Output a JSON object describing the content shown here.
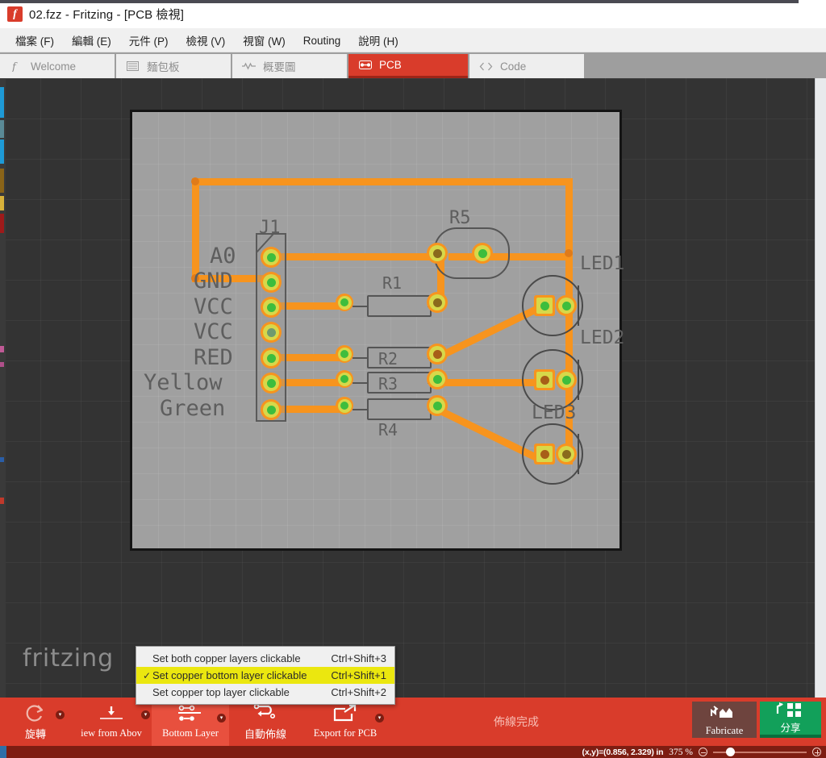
{
  "window": {
    "title": "02.fzz - Fritzing - [PCB 檢視]",
    "app_icon": "fritzing-logo-icon"
  },
  "menubar": {
    "items": [
      {
        "label": "檔案 (F)",
        "name": "menu-file"
      },
      {
        "label": "編輯 (E)",
        "name": "menu-edit"
      },
      {
        "label": "元件 (P)",
        "name": "menu-part"
      },
      {
        "label": "檢視 (V)",
        "name": "menu-view"
      },
      {
        "label": "視窗 (W)",
        "name": "menu-window"
      },
      {
        "label": "Routing",
        "name": "menu-routing"
      },
      {
        "label": "說明 (H)",
        "name": "menu-help"
      }
    ]
  },
  "tabs": [
    {
      "label": "Welcome",
      "icon": "fritzing-f-icon",
      "active": false
    },
    {
      "label": "麵包板",
      "icon": "breadboard-icon",
      "active": false
    },
    {
      "label": "概要圖",
      "icon": "schematic-icon",
      "active": false
    },
    {
      "label": "PCB",
      "icon": "pcb-icon",
      "active": true
    },
    {
      "label": "Code",
      "icon": "code-icon",
      "active": false
    }
  ],
  "canvas": {
    "watermark": "fritzing",
    "board": {
      "silkscreen": [
        {
          "text": "J1"
        },
        {
          "text": "A0"
        },
        {
          "text": "GND"
        },
        {
          "text": "VCC"
        },
        {
          "text": "VCC"
        },
        {
          "text": "RED"
        },
        {
          "text": "Yellow"
        },
        {
          "text": "Green"
        },
        {
          "text": "R1"
        },
        {
          "text": "R2"
        },
        {
          "text": "R3"
        },
        {
          "text": "R4"
        },
        {
          "text": "R5"
        },
        {
          "text": "LED1"
        },
        {
          "text": "LED2"
        },
        {
          "text": "LED3"
        }
      ],
      "connector_label": "J1",
      "pin_labels": [
        "A0",
        "GND",
        "VCC",
        "VCC",
        "RED",
        "Yellow",
        "Green"
      ],
      "resistors": [
        "R1",
        "R2",
        "R3",
        "R4",
        "R5"
      ],
      "leds": [
        "LED1",
        "LED2",
        "LED3"
      ],
      "trace_color": "#f7941e",
      "board_color": "#a0a0a0"
    }
  },
  "context_menu": {
    "items": [
      {
        "label": "Set both copper layers clickable",
        "accel": "Ctrl+Shift+3",
        "checked": false,
        "highlighted": false
      },
      {
        "label": "Set copper bottom layer clickable",
        "accel": "Ctrl+Shift+1",
        "checked": true,
        "highlighted": true
      },
      {
        "label": "Set copper top layer clickable",
        "accel": "Ctrl+Shift+2",
        "checked": false,
        "highlighted": false
      }
    ],
    "check_glyph": "✓",
    "highlight_color": "#ebe70f"
  },
  "bottom_toolbar": {
    "buttons": [
      {
        "label": "旋轉",
        "icon": "rotate-icon",
        "active": false,
        "has_caret": true
      },
      {
        "label": "iew from Abov",
        "icon": "view-from-above-icon",
        "active": false,
        "has_caret": true
      },
      {
        "label": "Bottom Layer",
        "icon": "bottom-layer-icon",
        "active": true,
        "has_caret": true
      },
      {
        "label": "自動佈線",
        "icon": "autoroute-icon",
        "active": false,
        "has_caret": false
      },
      {
        "label": "Export for PCB",
        "icon": "export-icon",
        "active": false,
        "has_caret": true
      }
    ],
    "status_text": "佈線完成",
    "fabricate": {
      "label": "Fabricate",
      "icon": "fabricate-icon",
      "color": "#6e443e"
    },
    "share": {
      "label": "分享",
      "icon": "share-icon",
      "color": "#12a05a"
    }
  },
  "statusbar": {
    "coordinates": "(x,y)=(0.856, 2.329) in",
    "zoom": "375 %",
    "zoom_out_icon": "minus-circle-icon",
    "zoom_in_icon": "plus-circle-icon"
  }
}
